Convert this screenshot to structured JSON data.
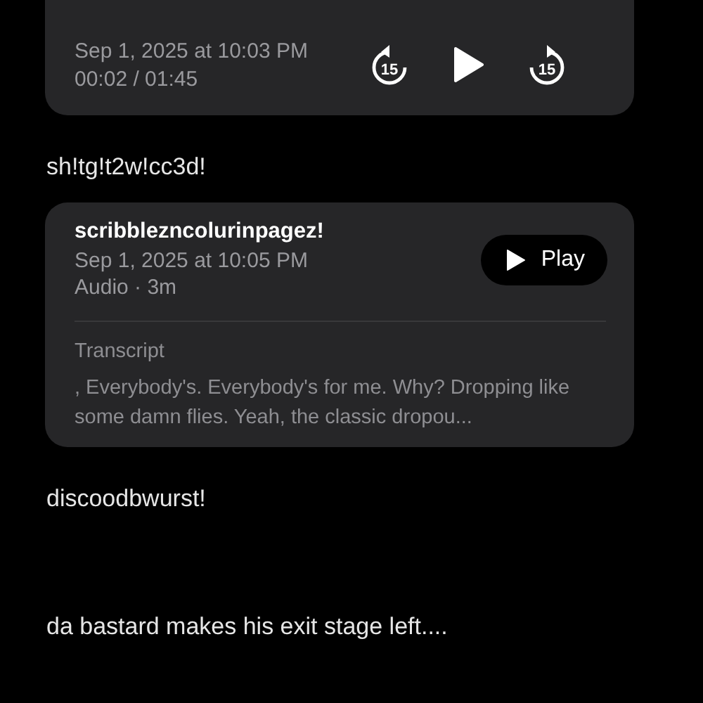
{
  "items": [
    {
      "kind": "player",
      "date": "Sep 1, 2025 at 10:03 PM",
      "time": "00:02 / 01:45",
      "skip_back": "15",
      "skip_forward": "15",
      "playing": false
    },
    {
      "kind": "note",
      "text": "sh!tg!t2w!cc3d!"
    },
    {
      "kind": "recording",
      "title": "scribblezncolurinpagez!",
      "date": "Sep 1, 2025 at 10:05 PM",
      "meta": "Audio · 3m",
      "button": "Play",
      "transcript_label": "Transcript",
      "transcript": ", Everybody's. Everybody's for me. Why? Dropping like some damn flies. Yeah, the classic dropou..."
    },
    {
      "kind": "note",
      "text": "discoodbwurst!"
    },
    {
      "kind": "note",
      "text": "da bastard makes his exit stage left...."
    }
  ]
}
